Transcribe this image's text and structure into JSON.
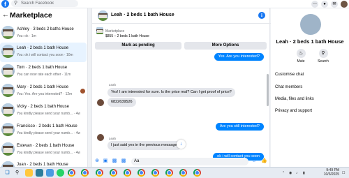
{
  "topbar": {
    "logo": "f",
    "search_placeholder": "Search Facebook",
    "icons": [
      "grid-icon",
      "messenger-icon",
      "bell-icon",
      "avatar"
    ]
  },
  "sidebar": {
    "title": "Marketplace",
    "items": [
      {
        "name": "Ashley · 3 beds 2 baths House",
        "snippet": "You: ok · 1m"
      },
      {
        "name": "Leah · 2 beds 1 bath House",
        "snippet": "You: ok i will contact you soon · 10m"
      },
      {
        "name": "Tom · 2 beds 1 bath House",
        "snippet": "You can now rate each other · 11m"
      },
      {
        "name": "Mary · 2 beds 1 bath House",
        "snippet": "You: Yes. Are you interested? · 12m"
      },
      {
        "name": "Vicky · 2 beds 1 bath House",
        "snippet": "You kindly please send your numb... · 4w"
      },
      {
        "name": "Francisco · 2 beds 1 bath House",
        "snippet": "You kindly please send your numb... · 4w"
      },
      {
        "name": "Estevan · 2 beds 1 bath House",
        "snippet": "You kindly please send your numb... · 4w"
      },
      {
        "name": "Juan · 2 beds 1 bath House",
        "snippet": ""
      }
    ]
  },
  "chat": {
    "title": "Leah · 2 beds 1 bath House",
    "listing": {
      "label": "Marketplace",
      "price": "$855 – 2 beds 1 bath House"
    },
    "buttons": {
      "pending": "Mark as pending",
      "more": "More Options"
    },
    "messages": {
      "out1": "Yes. Are you interested?",
      "sender1": "Leah",
      "in1": "Yes! I am interested for sure. Is the price real? Can I get proof of price?",
      "in2": "6822639526",
      "out2": "Are you still interested?",
      "sender2": "Leah",
      "in3": "I just said yes in the previous message.",
      "out3": "ok i will contact you soon"
    },
    "composer": {
      "value": "Aa"
    }
  },
  "right_panel": {
    "name": "Leah · 2 beds 1 bath House",
    "actions": {
      "mute": "Mute",
      "search": "Search"
    },
    "menu": [
      "Customise chat",
      "Chat members",
      "Media, files and links",
      "Privacy and support"
    ]
  },
  "taskbar": {
    "time": "9:49 PM",
    "date": "10/3/2025"
  },
  "colors": {
    "accent": "#1877f2",
    "bubble_out": "#0084ff",
    "bubble_in": "#e4e6eb"
  }
}
